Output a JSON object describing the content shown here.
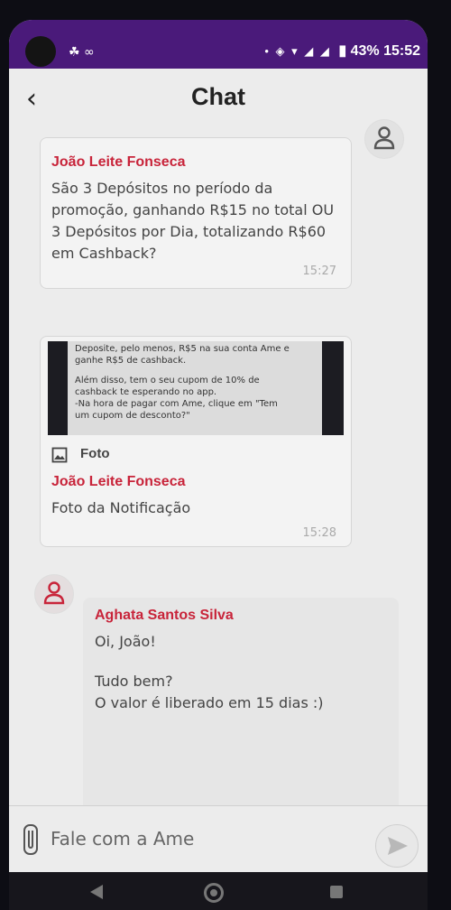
{
  "status_bar": {
    "left_icons": "☘ ∞",
    "right_icons": "• ◈ ▾ ◢ ◢",
    "battery": "43%",
    "time": "15:52"
  },
  "header": {
    "back_icon": "‹",
    "title": "Chat"
  },
  "messages": [
    {
      "sender": "João Leite Fonseca",
      "text": "São 3 Depósitos no período da promoção, ganhando R$15 no total OU 3 Depósitos por Dia, totalizando R$60 em Cashback?",
      "time": "15:27"
    },
    {
      "photo_text": {
        "line1": "Deposite, pelo menos, R$5 na sua conta Ame e",
        "line2": "ganhe R$5 de cashback.",
        "line3": "Além disso, tem o seu cupom de 10% de",
        "line4": "cashback te esperando no app.",
        "line5": "-Na hora de pagar com Ame, clique em \"Tem",
        "line6": "um cupom de desconto?\""
      },
      "attachment_label": "Foto",
      "sender": "João Leite Fonseca",
      "text": "Foto da Notificação",
      "time": "15:28"
    },
    {
      "sender": "Aghata Santos Silva",
      "greeting": "Oi, João!",
      "line2": "Tudo bem?",
      "line3": "O valor é liberado em 15 dias :)"
    }
  ],
  "composer": {
    "placeholder": "Fale com a Ame"
  },
  "colors": {
    "accent": "#c8243a",
    "status_bar": "#4a1a7a"
  }
}
